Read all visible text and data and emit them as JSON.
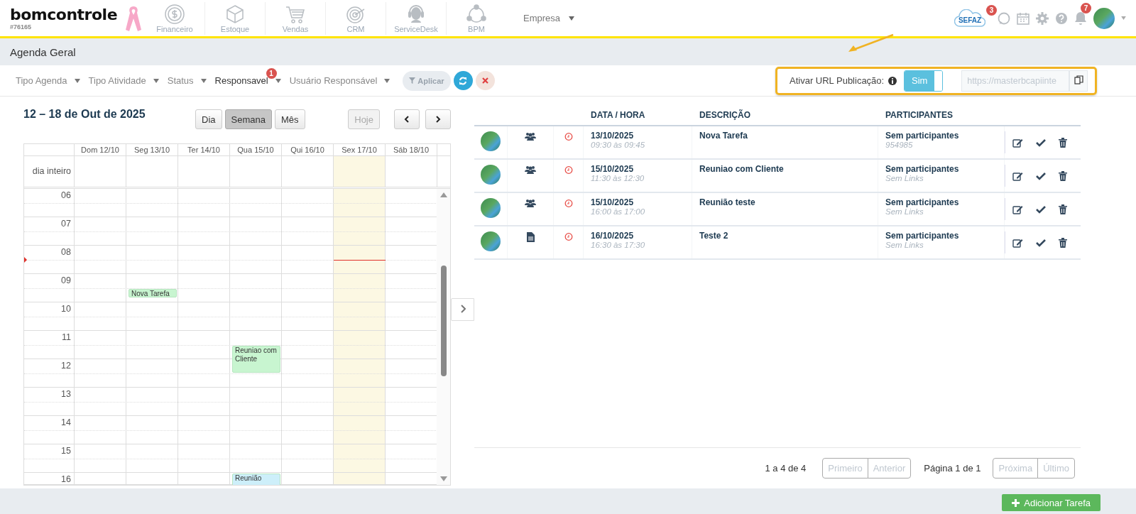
{
  "app": {
    "logo": "bomcontrole",
    "account": "#76165"
  },
  "modules": [
    {
      "label": "Financeiro"
    },
    {
      "label": "Estoque"
    },
    {
      "label": "Vendas"
    },
    {
      "label": "CRM"
    },
    {
      "label": "ServiceDesk"
    },
    {
      "label": "BPM"
    }
  ],
  "company_menu": {
    "label": "Empresa"
  },
  "header_icons": {
    "sefaz": {
      "label": "SEFAZ",
      "badge": "3"
    },
    "notifications": {
      "badge": "7"
    }
  },
  "page_title": "Agenda Geral",
  "filters": [
    {
      "label": "Tipo Agenda",
      "active": false
    },
    {
      "label": "Tipo Atividade",
      "active": false
    },
    {
      "label": "Status",
      "active": false
    },
    {
      "label": "Responsavel",
      "active": true,
      "badge": "1"
    },
    {
      "label": "Usuário Responsável",
      "active": false
    }
  ],
  "filter_actions": {
    "apply": "Aplicar"
  },
  "publication": {
    "label": "Ativar URL Publicação:",
    "toggle": {
      "label": "Sim",
      "on": true
    },
    "url": "https://masterbcapiinte"
  },
  "calendar": {
    "title": "12 – 18 de Out de 2025",
    "views": [
      {
        "label": "Dia",
        "selected": false
      },
      {
        "label": "Semana",
        "selected": true
      },
      {
        "label": "Mês",
        "selected": false
      }
    ],
    "today_button": {
      "label": "Hoje",
      "disabled": true
    },
    "all_day_label": "dia inteiro",
    "days": [
      {
        "label": "Dom 12/10",
        "today": false
      },
      {
        "label": "Seg 13/10",
        "today": false
      },
      {
        "label": "Ter 14/10",
        "today": false
      },
      {
        "label": "Qua 15/10",
        "today": false
      },
      {
        "label": "Qui 16/10",
        "today": false
      },
      {
        "label": "Sex 17/10",
        "today": true
      },
      {
        "label": "Sáb 18/10",
        "today": false
      }
    ],
    "hours": [
      "06",
      "07",
      "08",
      "09",
      "10",
      "11",
      "12",
      "13",
      "14",
      "15",
      "16"
    ],
    "events": [
      {
        "title": "Nova Tarefa",
        "color": "#c8f5d0"
      },
      {
        "title": "Reuniao com Cliente",
        "color": "#c8f5d0"
      },
      {
        "title": "Reunião",
        "color": "#cdeffa"
      }
    ]
  },
  "table": {
    "columns": [
      "DATA / HORA",
      "DESCRIÇÃO",
      "PARTICIPANTES"
    ],
    "rows": [
      {
        "kind": "meeting",
        "date": "13/10/2025",
        "time": "09:30 às 09:45",
        "description": "Nova Tarefa",
        "participants": "Sem participantes",
        "links": "954985"
      },
      {
        "kind": "meeting",
        "date": "15/10/2025",
        "time": "11:30 às 12:30",
        "description": "Reuniao com Cliente",
        "participants": "Sem participantes",
        "links": "Sem Links"
      },
      {
        "kind": "meeting",
        "date": "15/10/2025",
        "time": "16:00 às 17:00",
        "description": "Reunião teste",
        "participants": "Sem participantes",
        "links": "Sem Links"
      },
      {
        "kind": "task",
        "date": "16/10/2025",
        "time": "16:30 às 17:30",
        "description": "Teste 2",
        "participants": "Sem participantes",
        "links": "Sem Links"
      }
    ]
  },
  "pagination": {
    "summary": "1 a 4 de 4",
    "page": "Página 1 de 1",
    "buttons": [
      {
        "label": "Primeiro",
        "disabled": true
      },
      {
        "label": "Anterior",
        "disabled": true
      },
      {
        "label": "Próxima",
        "disabled": true
      },
      {
        "label": "Último",
        "disabled": true
      }
    ]
  },
  "add_button": "Adicionar Tarefa"
}
